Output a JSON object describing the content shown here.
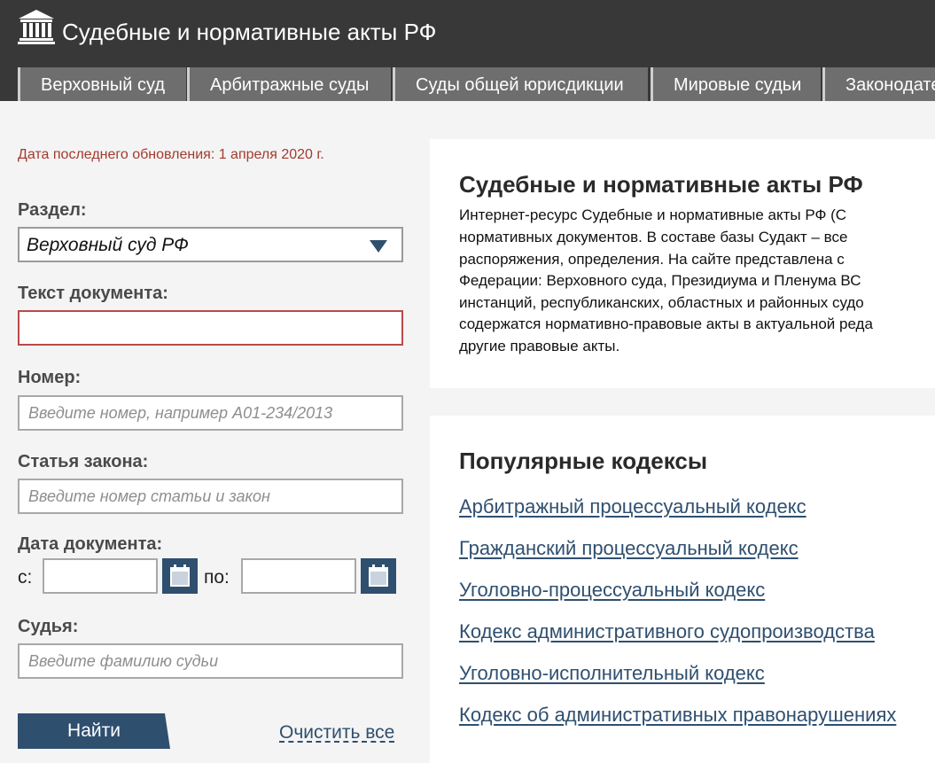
{
  "header": {
    "title": "Судебные и нормативные акты РФ",
    "logo_icon": "courthouse-icon"
  },
  "tabs": [
    {
      "label": "Верховный суд"
    },
    {
      "label": "Арбитражные суды"
    },
    {
      "label": "Суды общей юрисдикции"
    },
    {
      "label": "Мировые судьи"
    },
    {
      "label": "Законодательство"
    }
  ],
  "search": {
    "updated_text": "Дата последнего обновления: 1 апреля 2020 г.",
    "section_label": "Раздел:",
    "section_value": "Верховный суд РФ",
    "doc_text_label": "Текст документа:",
    "doc_text_value": "",
    "number_label": "Номер:",
    "number_placeholder": "Введите номер, например А01-234/2013",
    "article_label": "Статья закона:",
    "article_placeholder": "Введите номер статьи и закон",
    "date_label": "Дата документа:",
    "date_from_label": "с:",
    "date_to_label": "по:",
    "judge_label": "Судья:",
    "judge_placeholder": "Введите фамилию судьи",
    "find_button": "Найти",
    "clear_link": "Очистить все"
  },
  "intro": {
    "title": "Судебные и нормативные акты РФ",
    "lines": [
      "Интернет-ресурс Судебные и нормативные акты РФ (С",
      "нормативных документов. В составе базы Судакт – все",
      "распоряжения, определения. На сайте представлена с",
      "Федерации: Верховного суда, Президиума и Пленума ВС",
      "инстанций, республиканских, областных и районных судо",
      "содержатся нормативно-правовые акты в актуальной реда",
      "другие правовые акты."
    ]
  },
  "popular": {
    "title": "Популярные кодексы",
    "links": [
      "Арбитражный процессуальный кодекс",
      "Гражданский процессуальный кодекс",
      "Уголовно-процессуальный кодекс",
      "Кодекс административного судопроизводства",
      "Уголовно-исполнительный кодекс",
      "Кодекс об административных правонарушениях"
    ]
  },
  "colors": {
    "header_bg": "#383838",
    "tab_bg": "#6e6e6e",
    "accent_blue": "#2f4f6f",
    "update_red": "#a33a2f"
  }
}
